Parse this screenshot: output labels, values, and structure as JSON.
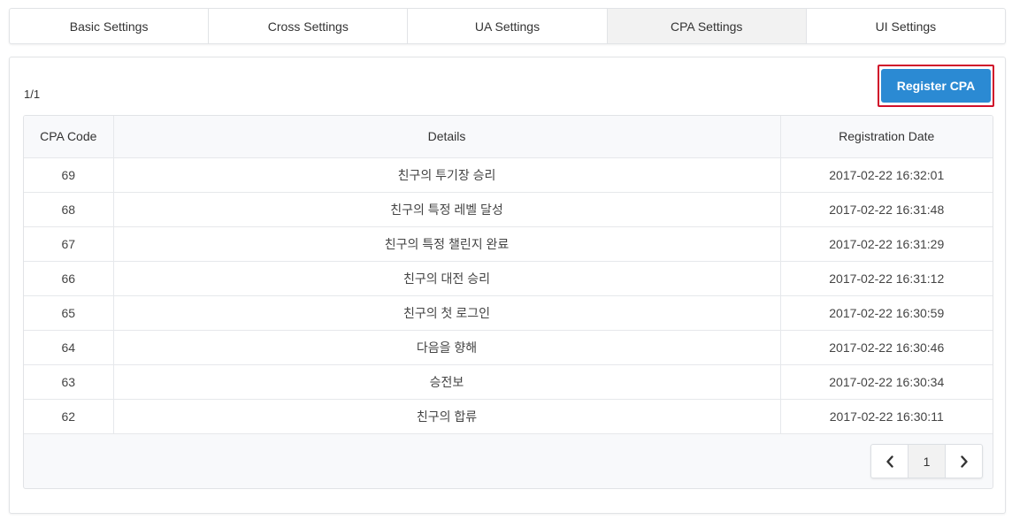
{
  "tabs": [
    {
      "label": "Basic Settings",
      "active": false
    },
    {
      "label": "Cross Settings",
      "active": false
    },
    {
      "label": "UA Settings",
      "active": false
    },
    {
      "label": "CPA Settings",
      "active": true
    },
    {
      "label": "UI Settings",
      "active": false
    }
  ],
  "page_count": "1/1",
  "register_label": "Register CPA",
  "table": {
    "headers": [
      "CPA Code",
      "Details",
      "Registration Date"
    ],
    "rows": [
      {
        "code": "69",
        "details": "친구의 투기장 승리",
        "date": "2017-02-22 16:32:01"
      },
      {
        "code": "68",
        "details": "친구의 특정 레벨 달성",
        "date": "2017-02-22 16:31:48"
      },
      {
        "code": "67",
        "details": "친구의 특정 챌린지 완료",
        "date": "2017-02-22 16:31:29"
      },
      {
        "code": "66",
        "details": "친구의 대전 승리",
        "date": "2017-02-22 16:31:12"
      },
      {
        "code": "65",
        "details": "친구의 첫 로그인",
        "date": "2017-02-22 16:30:59"
      },
      {
        "code": "64",
        "details": "다음을 향해",
        "date": "2017-02-22 16:30:46"
      },
      {
        "code": "63",
        "details": "승전보",
        "date": "2017-02-22 16:30:34"
      },
      {
        "code": "62",
        "details": "친구의 합류",
        "date": "2017-02-22 16:30:11"
      }
    ]
  },
  "pagination": {
    "current": "1",
    "prev_icon": "chevron-left-icon",
    "next_icon": "chevron-right-icon"
  },
  "colors": {
    "accent": "#2b8ad3",
    "highlight_border": "#d0102a"
  }
}
